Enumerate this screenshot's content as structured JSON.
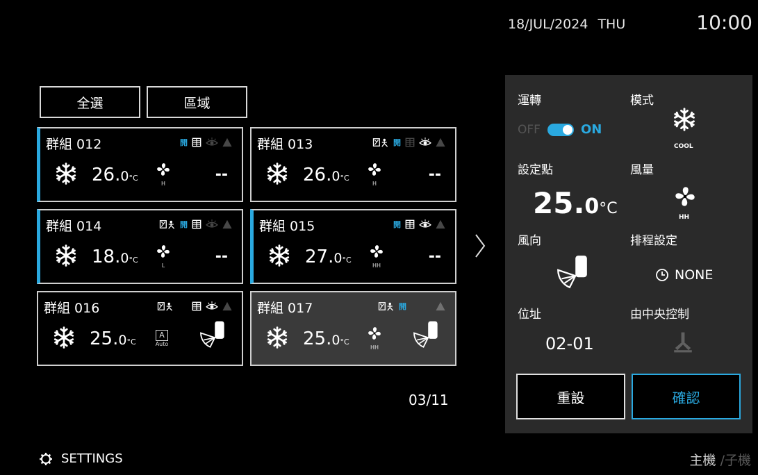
{
  "header": {
    "date": "18/JUL/2024",
    "day": "THU",
    "time": "10:00"
  },
  "toolbar": {
    "select_all": "全選",
    "area": "區域"
  },
  "groups": [
    {
      "name": "群組 012",
      "temp_int": "26.",
      "temp_dec": "0",
      "unit": "°C",
      "fan": "H",
      "right": "--"
    },
    {
      "name": "群組 013",
      "temp_int": "26.",
      "temp_dec": "0",
      "unit": "°C",
      "fan": "H",
      "right": "--"
    },
    {
      "name": "群組 014",
      "temp_int": "18.",
      "temp_dec": "0",
      "unit": "°C",
      "fan": "L",
      "right": "--"
    },
    {
      "name": "群組 015",
      "temp_int": "27.",
      "temp_dec": "0",
      "unit": "°C",
      "fan": "HH",
      "right": "--"
    },
    {
      "name": "群組 016",
      "temp_int": "25.",
      "temp_dec": "0",
      "unit": "°C",
      "fan": "Auto",
      "fan_box": "A"
    },
    {
      "name": "群組 017",
      "temp_int": "25.",
      "temp_dec": "0",
      "unit": "°C",
      "fan": "HH"
    }
  ],
  "status_icons": {
    "open": "開"
  },
  "pagination": {
    "page": "03/11"
  },
  "footer": {
    "settings": "SETTINGS",
    "unit_main": "主機",
    "unit_sub": " /子機"
  },
  "panel": {
    "operation_label": "運轉",
    "mode_label": "模式",
    "off": "OFF",
    "on": "ON",
    "mode_value": "COOL",
    "setpoint_label": "設定點",
    "setpoint_int": "25.",
    "setpoint_dec": "0",
    "setpoint_unit": "°C",
    "fan_label": "風量",
    "fan_value": "HH",
    "direction_label": "風向",
    "schedule_label": "排程設定",
    "schedule_value": "NONE",
    "address_label": "位址",
    "address_value": "02-01",
    "central_label": "由中央控制",
    "reset_button": "重設",
    "confirm_button": "確認"
  },
  "colors": {
    "accent": "#2aa9e0",
    "panel": "#2a2a2a",
    "selected_card": "#3a3a3a"
  },
  "icons": [
    "snowflake-icon",
    "fan-icon",
    "louver-icon",
    "grid-icon",
    "eye-icon",
    "warning-icon",
    "network-icon",
    "chevron-right-icon",
    "gear-icon",
    "clock-icon",
    "central-control-icon"
  ]
}
